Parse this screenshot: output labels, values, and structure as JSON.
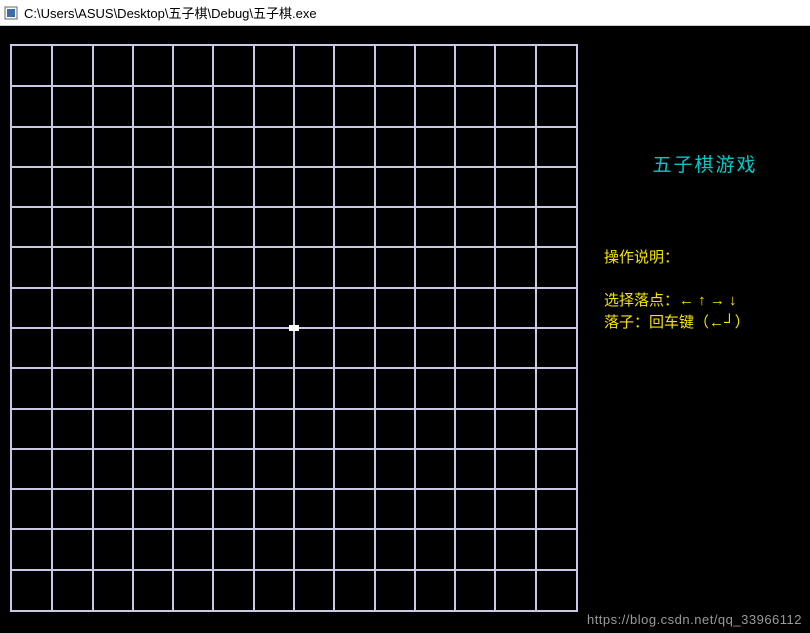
{
  "window": {
    "title": "C:\\Users\\ASUS\\Desktop\\五子棋\\Debug\\五子棋.exe"
  },
  "game": {
    "title": "五子棋游戏",
    "board": {
      "rows": 14,
      "cols": 14,
      "cursor": {
        "row": 7,
        "col": 7
      }
    },
    "instructions": {
      "heading": "操作说明：",
      "select_label": "选择落点：← ↑ → ↓",
      "place_label": "落子：回车键（←┘）"
    }
  },
  "watermark": "https://blog.csdn.net/qq_33966112"
}
